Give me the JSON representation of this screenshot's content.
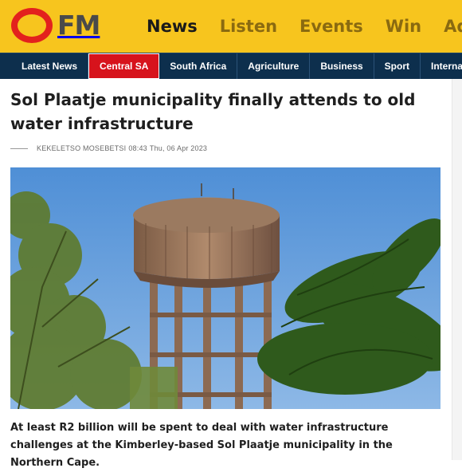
{
  "brand": {
    "logo_letters": "OFM",
    "logo_visible_text": "FM",
    "primary_color": "#f7c51e",
    "logo_color": "#e3211d"
  },
  "main_nav": [
    {
      "label": "News",
      "active": true
    },
    {
      "label": "Listen",
      "active": false
    },
    {
      "label": "Events",
      "active": false
    },
    {
      "label": "Win",
      "active": false
    },
    {
      "label": "Adve",
      "active": false
    }
  ],
  "sub_nav": [
    {
      "label": "Latest News",
      "active": false
    },
    {
      "label": "Central SA",
      "active": true
    },
    {
      "label": "South Africa",
      "active": false
    },
    {
      "label": "Agriculture",
      "active": false
    },
    {
      "label": "Business",
      "active": false
    },
    {
      "label": "Sport",
      "active": false
    },
    {
      "label": "Internatio",
      "active": false
    }
  ],
  "article": {
    "title": "Sol Plaatje municipality finally attends to old water infrastructure",
    "author": "KEKELETSO MOSEBETSI",
    "time": "08:43",
    "date": "Thu, 06 Apr 2023",
    "image_subject": "water-tower-photo",
    "lead": "At least R2 billion will be spent to deal with water infrastructure challenges at the Kimberley-based Sol Plaatje municipality in the Northern Cape."
  },
  "colors": {
    "subnav_bg": "#0d2f4d",
    "subnav_active": "#d7131c"
  }
}
